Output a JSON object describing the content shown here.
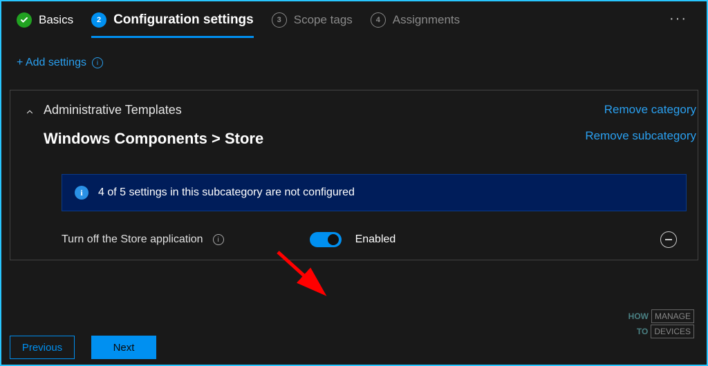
{
  "wizard": {
    "steps": [
      {
        "label": "Basics",
        "state": "done"
      },
      {
        "num": "2",
        "label": "Configuration settings",
        "state": "active"
      },
      {
        "num": "3",
        "label": "Scope tags",
        "state": "pending"
      },
      {
        "num": "4",
        "label": "Assignments",
        "state": "pending"
      }
    ]
  },
  "add_settings": "+ Add settings",
  "panel": {
    "category": "Administrative Templates",
    "subcategory": "Windows Components > Store",
    "remove_category": "Remove category",
    "remove_subcategory": "Remove subcategory"
  },
  "infobar": "4 of 5 settings in this subcategory are not configured",
  "setting": {
    "name": "Turn off the Store application",
    "state_label": "Enabled",
    "enabled": true
  },
  "footer": {
    "previous": "Previous",
    "next": "Next"
  },
  "watermark": {
    "how": "HOW",
    "to": "TO",
    "manage": "MANAGE",
    "devices": "DEVICES"
  }
}
